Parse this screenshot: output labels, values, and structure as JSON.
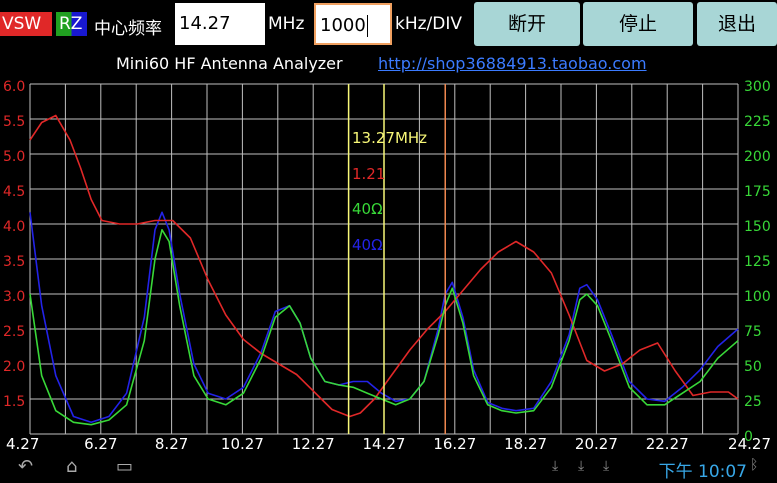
{
  "topbar": {
    "vsw_tab": "VSW",
    "rz_tab": "RZ",
    "center_freq_label": "中心频率",
    "center_freq_value": "14.27",
    "mhz_unit": "MHz",
    "span_value": "1000",
    "span_unit": "kHz/DIV",
    "disconnect_button": "断开",
    "stop_button": "停止",
    "exit_button": "退出"
  },
  "subtitle": {
    "app_name": "Mini60 HF Antenna Analyzer",
    "url": "http://shop36884913.taobao.com"
  },
  "statusbar": {
    "clock": "下午 10:07"
  },
  "colors": {
    "vswr": "#e02828",
    "r": "#38d838",
    "z": "#2323e8",
    "grid": "#bfbfbf",
    "left_axis": "#e02828",
    "right_axis": "#38d838",
    "x_axis": "#ffffff",
    "marker_yellow": "#f8f878",
    "marker_orange": "#f08850",
    "vsw_bg": "#e02828",
    "rz_r_bg": "#20a020",
    "rz_z_bg": "#1818d0",
    "button_bg": "#a8d6d6"
  },
  "icons": {
    "back": "back-icon",
    "home": "home-icon",
    "recent": "recent-apps-icon",
    "download1": "download-icon",
    "download2": "download-icon",
    "download3": "download-icon",
    "android": "android-icon",
    "bluetooth": "bluetooth-icon",
    "signal": "signal-icon"
  },
  "chart_data": {
    "type": "line",
    "title": "",
    "xlabel": "MHz",
    "ylabel": "",
    "xlim": [
      4.27,
      24.27
    ],
    "ylim": [
      1.0,
      6.0
    ],
    "y2lim": [
      0,
      300
    ],
    "x_ticks": [
      "4.27",
      "6.27",
      "8.27",
      "10.27",
      "12.27",
      "14.27",
      "16.27",
      "18.27",
      "20.27",
      "22.27",
      "24.27"
    ],
    "y_ticks": [
      "1.5",
      "2.0",
      "2.5",
      "3.0",
      "3.5",
      "4.0",
      "4.5",
      "5.0",
      "5.5",
      "6.0"
    ],
    "y2_ticks": [
      "0",
      "25",
      "50",
      "75",
      "100",
      "125",
      "150",
      "175",
      "200",
      "225",
      "300"
    ],
    "grid": true,
    "markers": [
      {
        "x": 13.27,
        "color": "#f8f878"
      },
      {
        "x": 14.27,
        "color": "#f8f878"
      },
      {
        "x": 16.0,
        "color": "#f08850"
      }
    ],
    "readout": {
      "freq": "13.27MHz",
      "vswr": "1.21",
      "r": "40Ω",
      "z": "40Ω"
    },
    "series": [
      {
        "key": "vswr",
        "axis": "left",
        "x": [
          4.27,
          4.6,
          5.0,
          5.4,
          5.7,
          6.0,
          6.3,
          6.8,
          7.3,
          7.8,
          8.3,
          8.8,
          9.3,
          9.8,
          10.3,
          10.8,
          11.3,
          11.8,
          12.3,
          12.8,
          13.3,
          13.6,
          14.0,
          14.5,
          15.0,
          15.5,
          16.0,
          16.5,
          17.0,
          17.5,
          18.0,
          18.5,
          19.0,
          19.5,
          20.0,
          20.5,
          21.0,
          21.5,
          22.0,
          22.5,
          23.0,
          23.5,
          24.0,
          24.27
        ],
        "values": [
          5.2,
          5.45,
          5.55,
          5.2,
          4.8,
          4.35,
          4.05,
          4.0,
          4.0,
          4.05,
          4.05,
          3.8,
          3.2,
          2.7,
          2.35,
          2.15,
          2.0,
          1.85,
          1.6,
          1.35,
          1.25,
          1.3,
          1.5,
          1.85,
          2.2,
          2.5,
          2.75,
          3.05,
          3.35,
          3.6,
          3.75,
          3.6,
          3.3,
          2.7,
          2.05,
          1.9,
          2.0,
          2.2,
          2.3,
          1.9,
          1.55,
          1.6,
          1.6,
          1.5
        ]
      },
      {
        "key": "r",
        "axis": "right",
        "x": [
          4.27,
          4.6,
          5.0,
          5.5,
          6.0,
          6.5,
          7.0,
          7.5,
          7.8,
          8.0,
          8.2,
          8.5,
          8.9,
          9.3,
          9.8,
          10.3,
          10.8,
          11.2,
          11.6,
          11.9,
          12.2,
          12.6,
          13.0,
          13.4,
          13.8,
          14.2,
          14.6,
          15.0,
          15.4,
          15.8,
          16.0,
          16.2,
          16.5,
          16.8,
          17.2,
          17.6,
          18.0,
          18.5,
          19.0,
          19.5,
          19.8,
          20.0,
          20.3,
          20.7,
          21.2,
          21.7,
          22.2,
          22.7,
          23.2,
          23.7,
          24.27
        ],
        "values": [
          120,
          50,
          20,
          10,
          8,
          12,
          25,
          80,
          150,
          175,
          165,
          110,
          50,
          30,
          25,
          35,
          65,
          100,
          110,
          95,
          65,
          45,
          42,
          40,
          35,
          30,
          25,
          30,
          45,
          85,
          110,
          125,
          95,
          50,
          25,
          20,
          18,
          20,
          40,
          80,
          115,
          120,
          110,
          80,
          40,
          25,
          25,
          35,
          45,
          65,
          80
        ]
      },
      {
        "key": "z",
        "axis": "right",
        "x": [
          4.27,
          4.6,
          5.0,
          5.5,
          6.0,
          6.5,
          7.0,
          7.5,
          7.8,
          8.0,
          8.2,
          8.5,
          8.9,
          9.3,
          9.8,
          10.3,
          10.8,
          11.2,
          11.6,
          11.9,
          12.2,
          12.6,
          13.0,
          13.4,
          13.8,
          14.2,
          14.6,
          15.0,
          15.4,
          15.8,
          16.0,
          16.2,
          16.5,
          16.8,
          17.2,
          17.6,
          18.0,
          18.5,
          19.0,
          19.5,
          19.8,
          20.0,
          20.3,
          20.7,
          21.2,
          21.7,
          22.2,
          22.7,
          23.2,
          23.7,
          24.27
        ],
        "values": [
          190,
          110,
          50,
          15,
          10,
          15,
          35,
          100,
          175,
          190,
          175,
          120,
          60,
          35,
          30,
          40,
          70,
          105,
          110,
          95,
          65,
          45,
          42,
          45,
          45,
          35,
          28,
          30,
          45,
          90,
          120,
          130,
          100,
          55,
          27,
          22,
          20,
          22,
          45,
          85,
          125,
          128,
          115,
          85,
          45,
          30,
          28,
          40,
          55,
          75,
          90
        ]
      }
    ]
  }
}
